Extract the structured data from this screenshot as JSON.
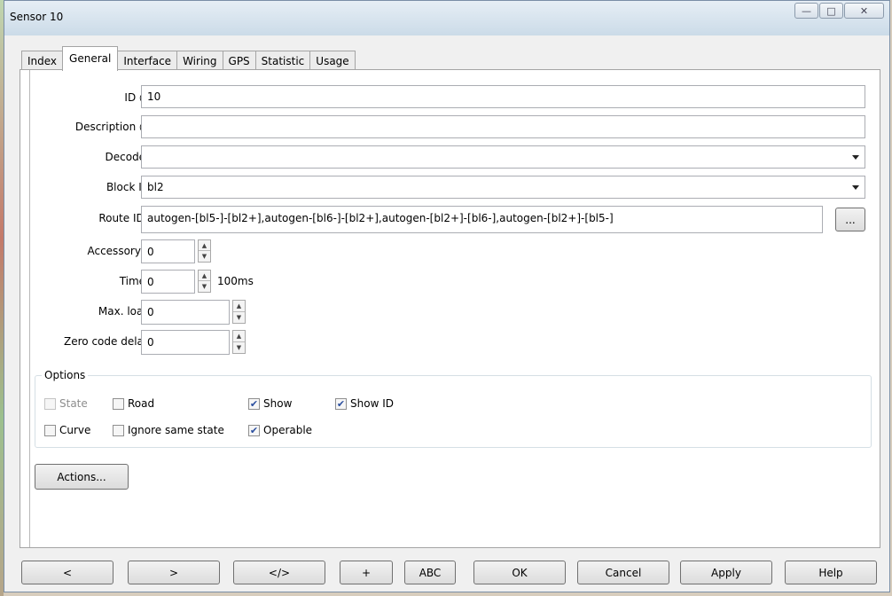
{
  "window": {
    "title": "Sensor 10",
    "controls": [
      "minimize",
      "maximize",
      "close"
    ]
  },
  "tabs": [
    "Index",
    "General",
    "Interface",
    "Wiring",
    "GPS",
    "Statistic",
    "Usage"
  ],
  "active_tab": "General",
  "form": {
    "id_label": "ID @",
    "id_value": "10",
    "description_label": "Description @",
    "description_value": "",
    "decoder_label": "Decoder",
    "decoder_value": "",
    "blockid_label": "Block ID",
    "blockid_value": "bl2",
    "routeids_label": "Route IDs",
    "routeids_value": "autogen-[bl5-]-[bl2+],autogen-[bl6-]-[bl2+],autogen-[bl2+]-[bl6-],autogen-[bl2+]-[bl5-]",
    "routeids_button": "...",
    "accessory_label": "Accessory#",
    "accessory_value": "0",
    "timer_label": "Timer",
    "timer_value": "0",
    "timer_unit": "100ms",
    "maxload_label": "Max. load",
    "maxload_value": "0",
    "zerocode_label": "Zero code delay",
    "zerocode_value": "0"
  },
  "options": {
    "title": "Options",
    "items": [
      {
        "label": "State",
        "checked": false,
        "disabled": true
      },
      {
        "label": "Road",
        "checked": false,
        "disabled": false
      },
      {
        "label": "Show",
        "checked": true,
        "disabled": false
      },
      {
        "label": "Show ID",
        "checked": true,
        "disabled": false
      },
      {
        "label": "Curve",
        "checked": false,
        "disabled": false
      },
      {
        "label": "Ignore same state",
        "checked": false,
        "disabled": false
      },
      {
        "label": "Operable",
        "checked": true,
        "disabled": false
      }
    ]
  },
  "actions_button": "Actions...",
  "bottom_buttons": [
    "<",
    ">",
    "</>",
    "+",
    "ABC",
    "OK",
    "Cancel",
    "Apply",
    "Help"
  ]
}
